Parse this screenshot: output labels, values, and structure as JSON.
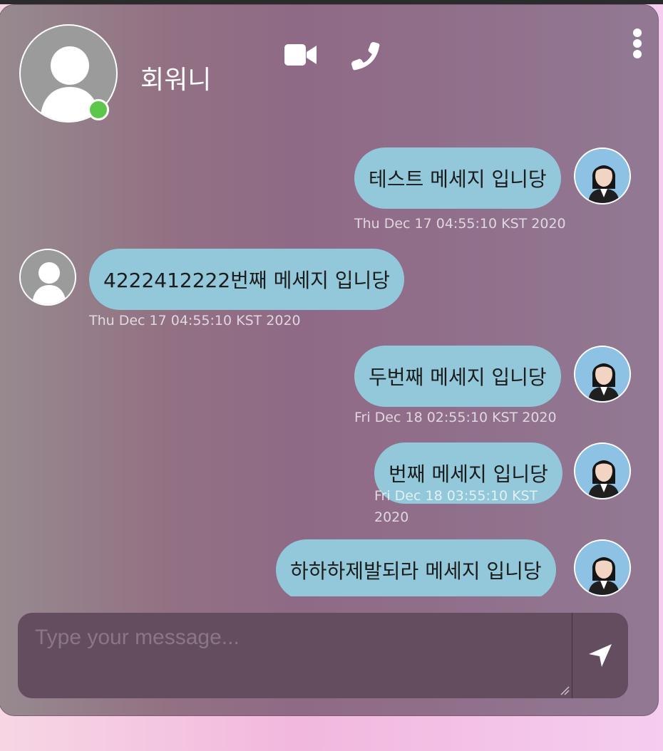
{
  "header": {
    "contact_name": "회워니",
    "status": "online",
    "icons": [
      "video-camera-icon",
      "phone-icon",
      "more-vertical-icon"
    ]
  },
  "messages": [
    {
      "side": "sent",
      "text": "테스트 메세지 입니당",
      "time": "Thu Dec 17 04:55:10 KST 2020"
    },
    {
      "side": "received",
      "text": "4222412222번째 메세지 입니당",
      "time": "Thu Dec 17 04:55:10 KST 2020"
    },
    {
      "side": "sent",
      "text": "두번째 메세지 입니당",
      "time": "Fri Dec 18 02:55:10 KST 2020"
    },
    {
      "side": "sent",
      "text": "번째 메세지 입니당",
      "time": "Fri Dec 18 03:55:10 KST 2020"
    },
    {
      "side": "sent",
      "text": "하하하제발되라 메세지 입니당",
      "time": ""
    }
  ],
  "composer": {
    "placeholder": "Type your message...",
    "value": ""
  },
  "colors": {
    "bubble": "#92c8da",
    "status_online": "#5dc74b",
    "composer_bg": "#654d60"
  }
}
